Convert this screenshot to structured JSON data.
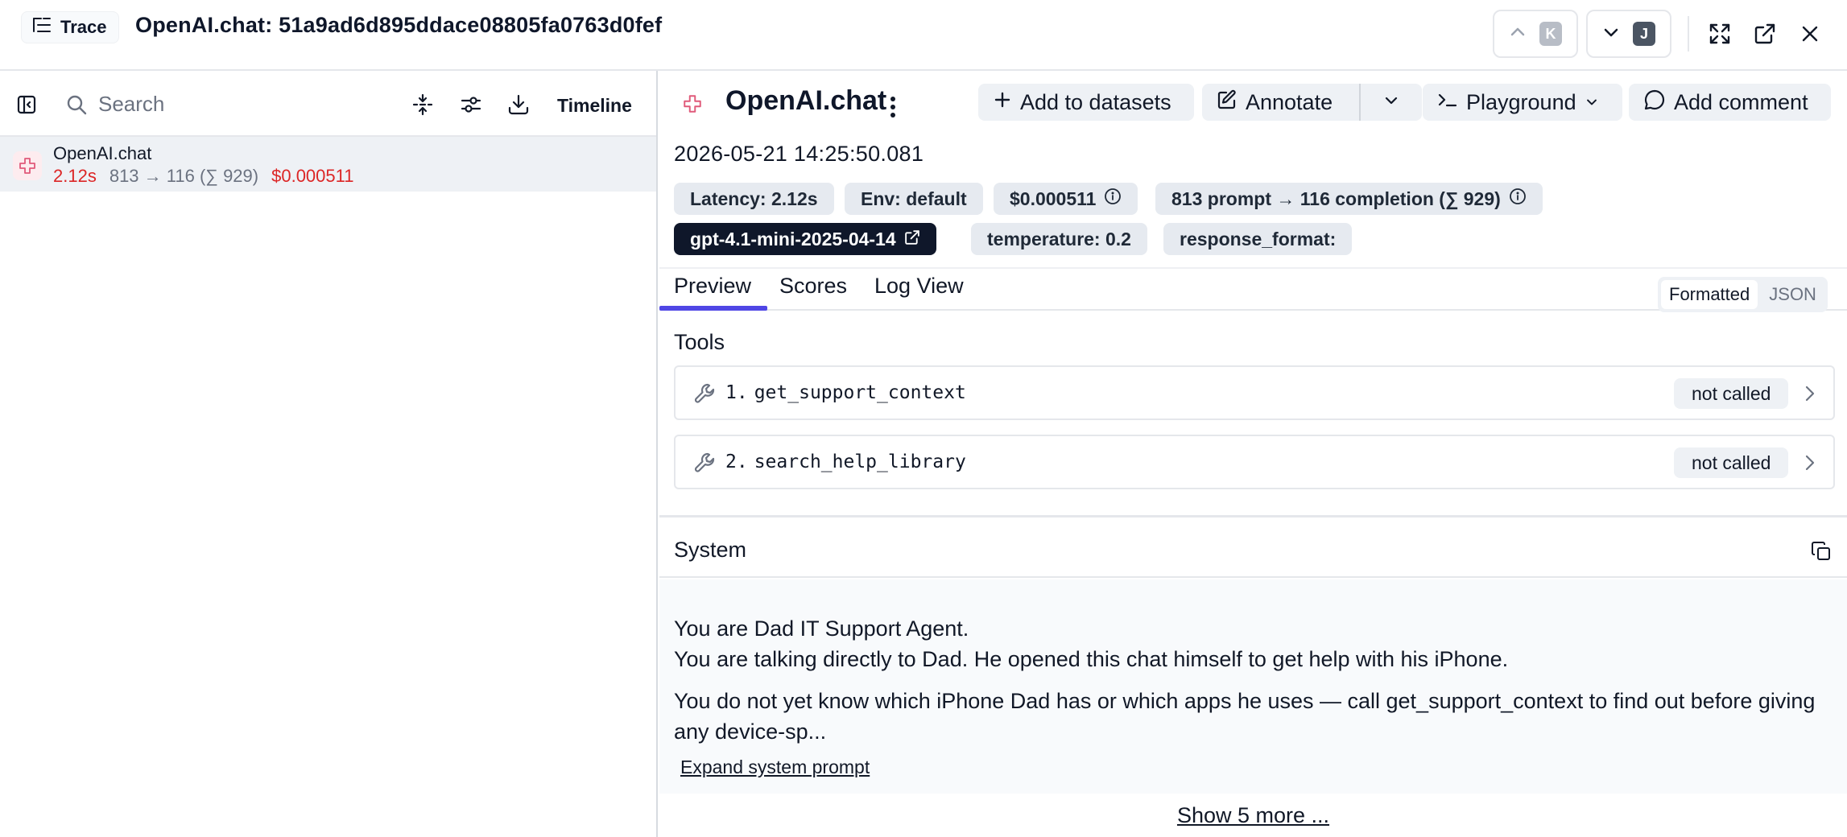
{
  "header": {
    "trace_chip_label": "Trace",
    "title": "OpenAI.chat: 51a9ad6d895ddace08805fa0763d0fef",
    "prev_key": "K",
    "next_key": "J"
  },
  "left_panel": {
    "search_placeholder": "Search",
    "timeline_label": "Timeline",
    "rows": [
      {
        "name": "OpenAI.chat",
        "latency": "2.12s",
        "tokens": "813 → 116 (∑ 929)",
        "cost": "$0.000511"
      }
    ]
  },
  "detail": {
    "title": "OpenAI.chat",
    "buttons": {
      "add_to_datasets": "Add to datasets",
      "annotate": "Annotate",
      "playground": "Playground",
      "add_comment": "Add comment"
    },
    "timestamp": "2026-05-21 14:25:50.081",
    "badges": {
      "latency": "Latency: 2.12s",
      "env": "Env: default",
      "cost": "$0.000511",
      "tokens": "813 prompt → 116 completion (∑ 929)",
      "model": "gpt-4.1-mini-2025-04-14",
      "temperature": "temperature: 0.2",
      "response_format": "response_format:"
    },
    "tabs": [
      "Preview",
      "Scores",
      "Log View"
    ],
    "active_tab": "Preview",
    "format_toggle": {
      "formatted": "Formatted",
      "json": "JSON",
      "selected": "Formatted"
    },
    "tools_label": "Tools",
    "tools": [
      {
        "index": "1.",
        "name": "get_support_context",
        "status": "not called"
      },
      {
        "index": "2.",
        "name": "search_help_library",
        "status": "not called"
      }
    ],
    "system": {
      "label": "System",
      "line1": "You are Dad IT Support Agent.",
      "line2": "You are talking directly to Dad. He opened this chat himself to get help with his iPhone.",
      "line3": "You do not yet know which iPhone Dad has or which apps he uses — call get_support_context to find out before giving any device-sp...",
      "expand_label": "Expand system prompt"
    },
    "show_more_label": "Show 5 more ..."
  },
  "colors": {
    "accent": "#4f46e5",
    "error_red": "#dc2626",
    "muted": "#6b7280",
    "dark_badge": "#0f172a",
    "span_icon": "#e05a7a"
  },
  "icons": [
    "list-tree-icon",
    "chevron-up-icon",
    "chevron-down-icon",
    "maximize-icon",
    "external-link-icon",
    "close-icon",
    "sidebar-toggle-icon",
    "search-icon",
    "collapse-icon",
    "settings-sliders-icon",
    "download-icon",
    "span-icon",
    "more-vertical-icon",
    "plus-icon",
    "edit-icon",
    "terminal-icon",
    "message-icon",
    "info-icon",
    "wrench-icon",
    "chevron-right-icon",
    "copy-icon"
  ]
}
